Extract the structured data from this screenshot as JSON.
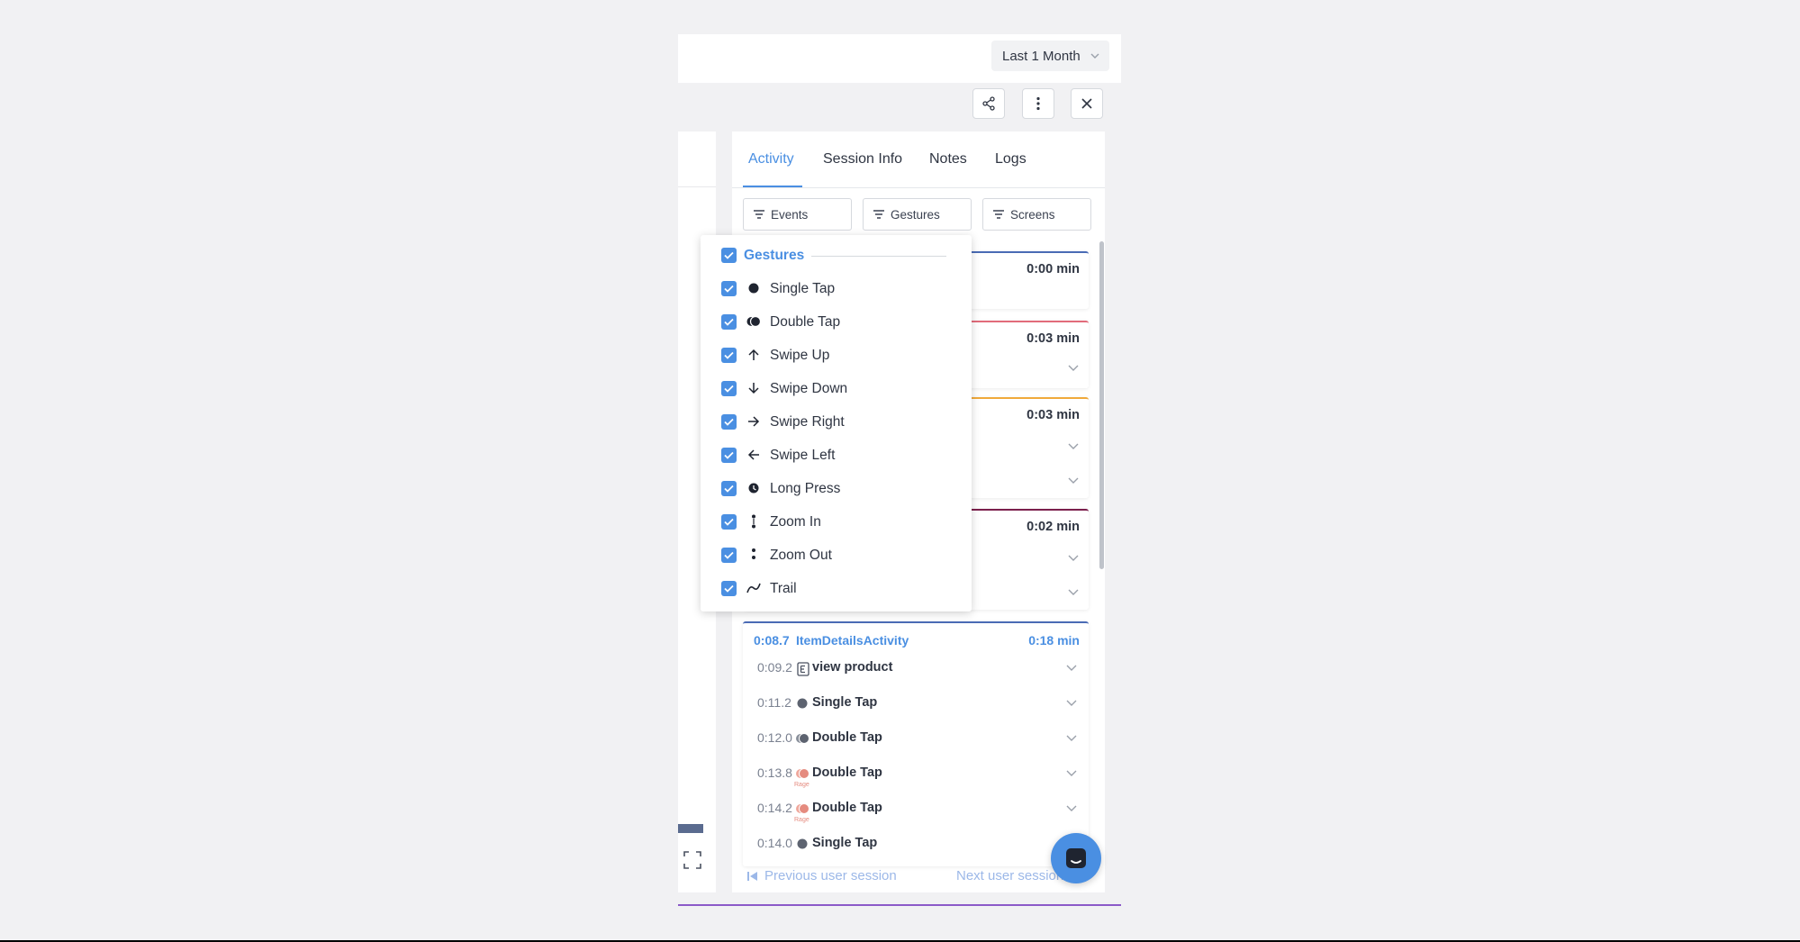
{
  "header": {
    "date_range": "Last 1 Month"
  },
  "toolbar": {
    "share_icon": "share-icon",
    "more_icon": "kebab-menu-icon",
    "close_icon": "close-icon"
  },
  "tabs": [
    {
      "label": "Activity",
      "active": true
    },
    {
      "label": "Session Info",
      "active": false
    },
    {
      "label": "Notes",
      "active": false
    },
    {
      "label": "Logs",
      "active": false
    }
  ],
  "filters": {
    "events": "Events",
    "gestures": "Gestures",
    "screens": "Screens"
  },
  "timeline_cards": [
    {
      "duration": "0:00 min",
      "color": "#4a6bb5"
    },
    {
      "duration": "0:03 min",
      "color": "#e26b7a"
    },
    {
      "duration": "0:03 min",
      "color": "#f0a93b"
    },
    {
      "duration": "0:02 min",
      "color": "#7b1f4c"
    }
  ],
  "screen": {
    "timestamp": "0:08.7",
    "name": "ItemDetailsActivity",
    "duration": "0:18 min",
    "events": [
      {
        "ts": "0:09.2",
        "label": "view product",
        "icon": "event-icon",
        "sub": ""
      },
      {
        "ts": "0:11.2",
        "label": "Single Tap",
        "icon": "single-tap-icon",
        "sub": ""
      },
      {
        "ts": "0:12.0",
        "label": "Double Tap",
        "icon": "double-tap-icon",
        "sub": ""
      },
      {
        "ts": "0:13.8",
        "label": "Double Tap",
        "icon": "rage-double-tap-icon",
        "sub": "Rage"
      },
      {
        "ts": "0:14.2",
        "label": "Double Tap",
        "icon": "rage-double-tap-icon",
        "sub": "Rage"
      },
      {
        "ts": "0:14.0",
        "label": "Single Tap",
        "icon": "single-tap-icon",
        "sub": ""
      }
    ]
  },
  "navigation": {
    "previous": "Previous user session",
    "next": "Next user session"
  },
  "gesture_menu": {
    "header": "Gestures",
    "items": [
      {
        "label": "Single Tap",
        "icon": "single-tap-icon",
        "checked": true
      },
      {
        "label": "Double Tap",
        "icon": "double-tap-icon",
        "checked": true
      },
      {
        "label": "Swipe Up",
        "icon": "arrow-up-icon",
        "checked": true
      },
      {
        "label": "Swipe Down",
        "icon": "arrow-down-icon",
        "checked": true
      },
      {
        "label": "Swipe Right",
        "icon": "arrow-right-icon",
        "checked": true
      },
      {
        "label": "Swipe Left",
        "icon": "arrow-left-icon",
        "checked": true
      },
      {
        "label": "Long Press",
        "icon": "long-press-icon",
        "checked": true
      },
      {
        "label": "Zoom In",
        "icon": "zoom-in-icon",
        "checked": true
      },
      {
        "label": "Zoom Out",
        "icon": "zoom-out-icon",
        "checked": true
      },
      {
        "label": "Trail",
        "icon": "trail-icon",
        "checked": true
      }
    ]
  },
  "colors": {
    "accent": "#4a8fe2",
    "rage": "#e58b7f"
  }
}
